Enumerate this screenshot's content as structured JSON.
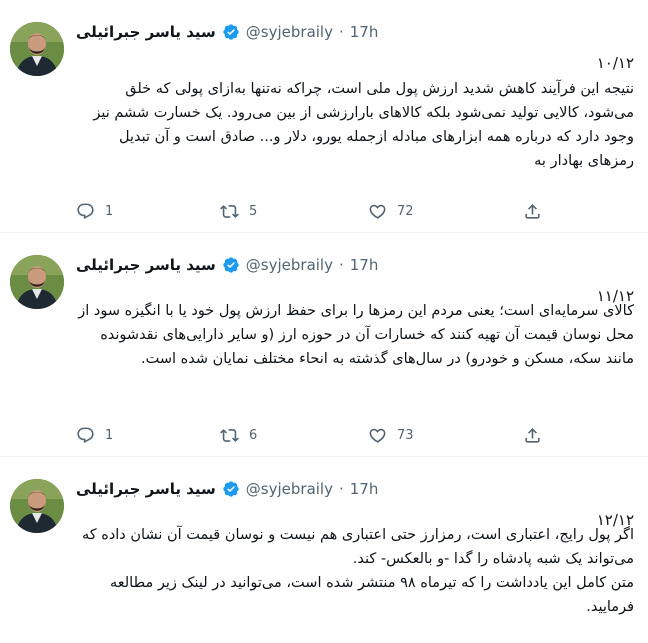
{
  "thread": {
    "tweets": [
      {
        "author": {
          "name": "سید یاسر جبرائیلی",
          "handle": "@syjebraily",
          "dot": "·",
          "time": "17h",
          "verified": true
        },
        "index": "۱۰/۱۲",
        "body": "نتیجه این فرآیند کاهش شدید ارزش پول ملی است، چراکه نه‌تنها به‌ازای پولی که خلق می‌شود، کالایی تولید نمی‌شود بلکه کالاهای بارارزشی از بین می‌رود. یک خسارت ششم نیز وجود دارد که درباره همه ابزارهای مبادله ازجمله یورو، دلار و... صادق است و آن تبدیل رمزهای بهادار به",
        "stats": {
          "replies": "1",
          "retweets": "5",
          "likes": "72"
        }
      },
      {
        "author": {
          "name": "سید یاسر جبرائیلی",
          "handle": "@syjebraily",
          "dot": "·",
          "time": "17h",
          "verified": true
        },
        "index": "۱۱/۱۲",
        "body": "کالای سرمایه‌ای است؛ یعنی مردم این رمزها را برای حفظ ارزش پول خود یا با انگیزه سود از محل نوسان قیمت آن تهیه کنند که خسارات آن در حوزه ارز (و سایر دارایی‌های نقدشونده مانند سکه، مسکن و خودرو) در سال‌های گذشته به انحاء مختلف نمایان شده است.",
        "stats": {
          "replies": "1",
          "retweets": "6",
          "likes": "73"
        }
      },
      {
        "author": {
          "name": "سید یاسر جبرائیلی",
          "handle": "@syjebraily",
          "dot": "·",
          "time": "17h",
          "verified": true
        },
        "index": "۱۲/۱۲",
        "body": "اگر پول رایج، اعتباری است، رمزارز حتی اعتباری هم نیست و نوسان قیمت آن نشان داده که می‌تواند یک شبه پادشاه را گدا -و بالعکس- کند.",
        "body2": "متن کامل این یادداشت را که تیرماه ۹۸ منتشر شده است، می‌توانید در لینک زیر مطالعه فرمایید."
      }
    ]
  },
  "icons": {
    "reply": "reply-icon",
    "retweet": "retweet-icon",
    "like": "heart-icon",
    "share": "share-icon",
    "verified": "verified-badge-icon"
  },
  "colors": {
    "verified": "#1d9bf0",
    "muted": "#536471",
    "text": "#0f1419",
    "divider": "#eff3f4"
  }
}
